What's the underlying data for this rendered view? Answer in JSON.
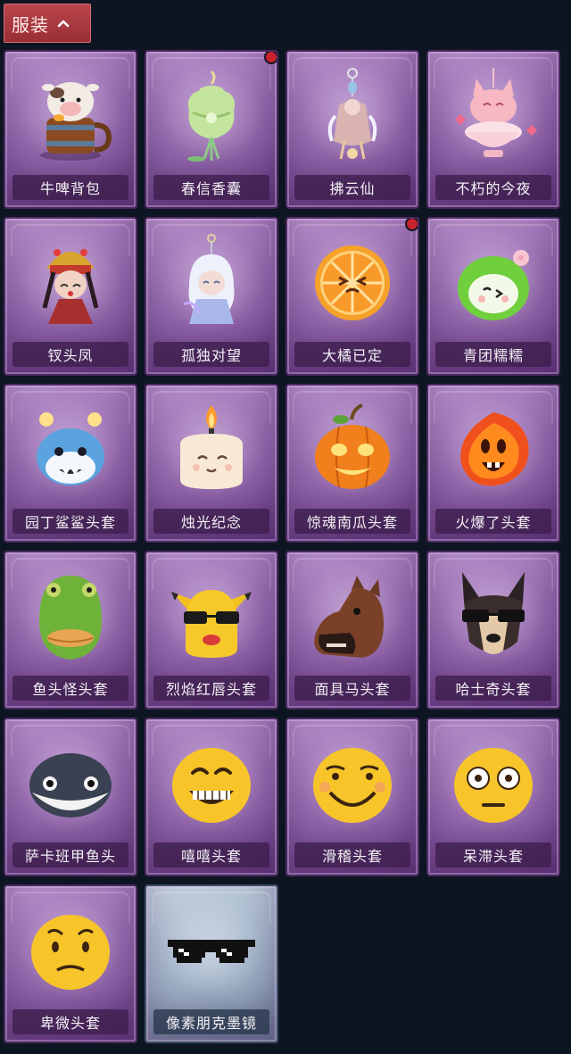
{
  "header": {
    "title": "服装"
  },
  "colors": {
    "badge": "#c8232c",
    "card_purple": "#8f63a8",
    "card_blue": "#9fb1c5",
    "header_red": "#b8454a"
  },
  "items": [
    {
      "label": "牛啤背包",
      "icon": "cow-beer-backpack-icon",
      "badge": false,
      "tint": "purple"
    },
    {
      "label": "春信香囊",
      "icon": "green-sachet-icon",
      "badge": true,
      "tint": "purple"
    },
    {
      "label": "拂云仙",
      "icon": "fairy-charm-icon",
      "badge": false,
      "tint": "purple"
    },
    {
      "label": "不朽的今夜",
      "icon": "pink-cat-bowl-icon",
      "badge": false,
      "tint": "purple"
    },
    {
      "label": "钗头凤",
      "icon": "opera-doll-icon",
      "badge": false,
      "tint": "purple"
    },
    {
      "label": "孤独对望",
      "icon": "white-hair-doll-icon",
      "badge": false,
      "tint": "purple"
    },
    {
      "label": "大橘已定",
      "icon": "orange-slice-icon",
      "badge": true,
      "tint": "purple"
    },
    {
      "label": "青团糯糯",
      "icon": "green-rice-ball-icon",
      "badge": false,
      "tint": "purple"
    },
    {
      "label": "园丁鲨鲨头套",
      "icon": "shark-head-icon",
      "badge": false,
      "tint": "purple"
    },
    {
      "label": "烛光纪念",
      "icon": "candle-head-icon",
      "badge": false,
      "tint": "purple"
    },
    {
      "label": "惊魂南瓜头套",
      "icon": "pumpkin-head-icon",
      "badge": false,
      "tint": "purple"
    },
    {
      "label": "火爆了头套",
      "icon": "fire-head-icon",
      "badge": false,
      "tint": "purple"
    },
    {
      "label": "鱼头怪头套",
      "icon": "fish-mask-icon",
      "badge": false,
      "tint": "purple"
    },
    {
      "label": "烈焰红唇头套",
      "icon": "yellow-mask-icon",
      "badge": false,
      "tint": "purple"
    },
    {
      "label": "面具马头套",
      "icon": "horse-mask-icon",
      "badge": false,
      "tint": "purple"
    },
    {
      "label": "哈士奇头套",
      "icon": "husky-mask-icon",
      "badge": false,
      "tint": "purple"
    },
    {
      "label": "萨卡班甲鱼头",
      "icon": "fish-head-icon",
      "badge": false,
      "tint": "purple"
    },
    {
      "label": "嘻嘻头套",
      "icon": "grin-emoji-icon",
      "badge": false,
      "tint": "purple"
    },
    {
      "label": "滑稽头套",
      "icon": "smirk-emoji-icon",
      "badge": false,
      "tint": "purple"
    },
    {
      "label": "呆滞头套",
      "icon": "stare-emoji-icon",
      "badge": false,
      "tint": "purple"
    },
    {
      "label": "卑微头套",
      "icon": "timid-emoji-icon",
      "badge": false,
      "tint": "purple"
    },
    {
      "label": "像素朋克墨镜",
      "icon": "pixel-sunglasses-icon",
      "badge": false,
      "tint": "blue"
    }
  ]
}
